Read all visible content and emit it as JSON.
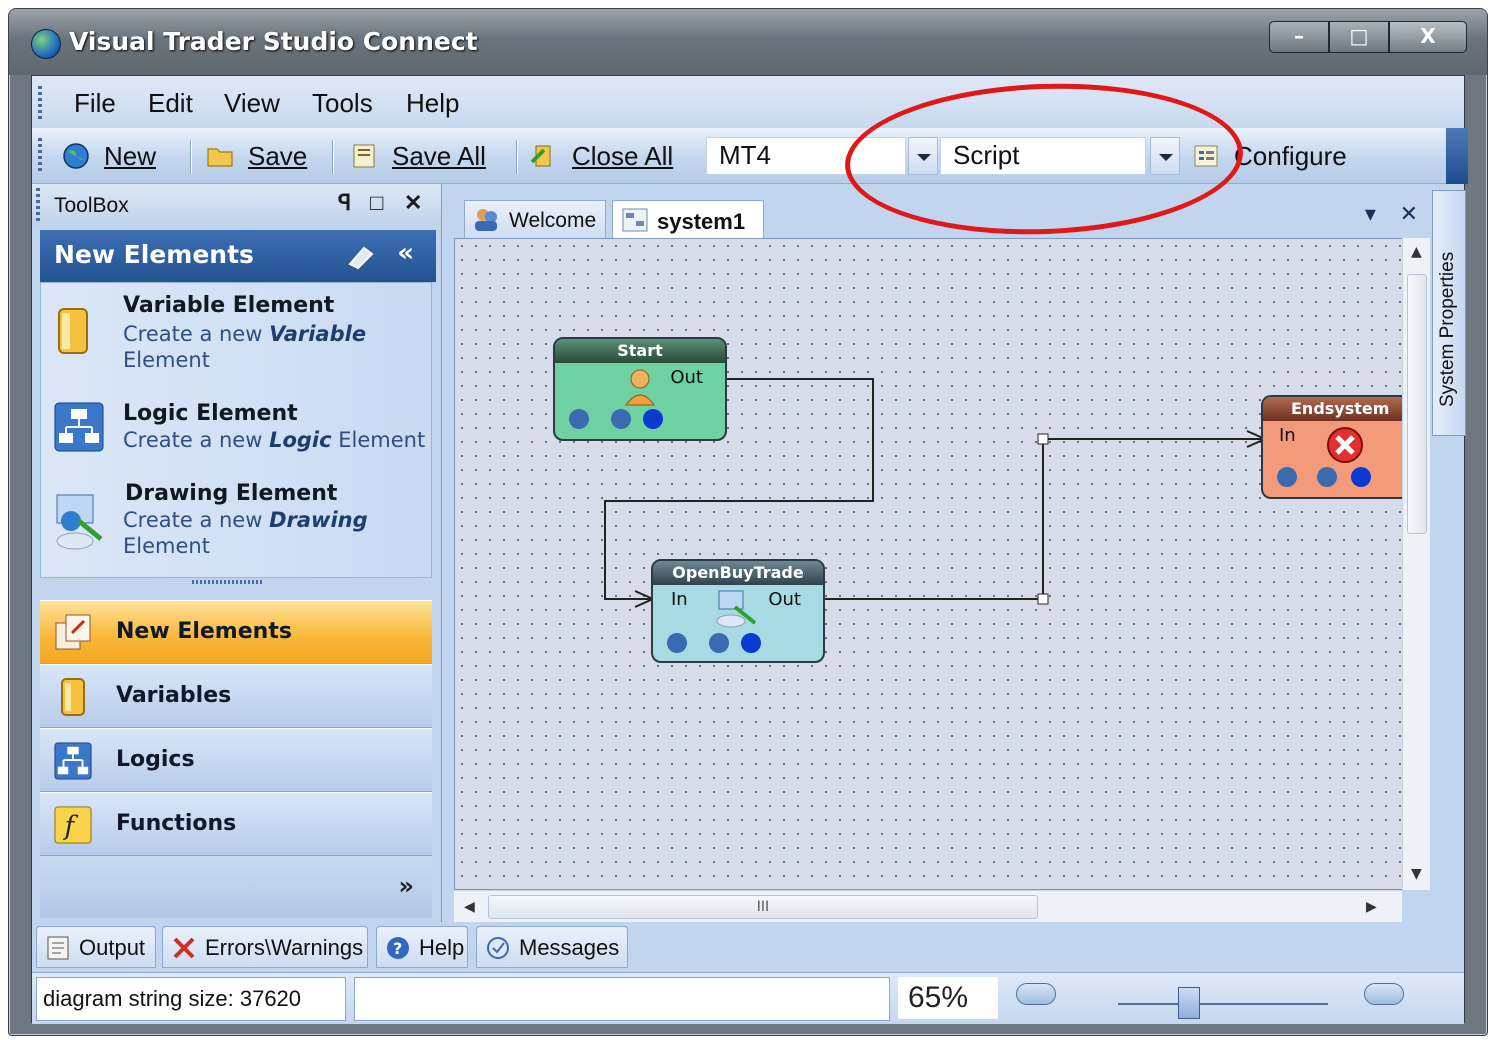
{
  "window": {
    "title": "Visual Trader Studio Connect",
    "buttons": [
      "–",
      "□",
      "X"
    ]
  },
  "menu": {
    "items": [
      "File",
      "Edit",
      "View",
      "Tools",
      "Help"
    ]
  },
  "toolbar": {
    "new_label": "New",
    "save_label": "Save",
    "save_all_label": "Save All",
    "close_all_label": "Close All",
    "platform_value": "MT4",
    "mode_value": "Script",
    "configure_label": "Configure"
  },
  "toolbox": {
    "title": "ToolBox",
    "header_buttons": [
      "ꟼ",
      "□",
      "✕"
    ],
    "section_title": "New Elements",
    "elements": [
      {
        "title": "Variable Element",
        "desc_pre": "Create  a new ",
        "desc_em": "Variable",
        "desc_post": " Element",
        "icon": "variable-icon"
      },
      {
        "title": "Logic Element",
        "desc_pre": "Create  a new ",
        "desc_em": "Logic",
        "desc_post": " Element",
        "icon": "logic-icon"
      },
      {
        "title": "Drawing Element",
        "desc_pre": "Create  a new ",
        "desc_em": "Drawing",
        "desc_post": " Element",
        "icon": "drawing-icon"
      }
    ],
    "nav": [
      {
        "label": "New Elements",
        "icon": "new-elements-icon",
        "active": true
      },
      {
        "label": "Variables",
        "icon": "variables-icon",
        "active": false
      },
      {
        "label": "Logics",
        "icon": "logics-icon",
        "active": false
      },
      {
        "label": "Functions",
        "icon": "functions-icon",
        "active": false
      }
    ]
  },
  "documents": {
    "tabs": [
      {
        "label": "Welcome",
        "active": false
      },
      {
        "label": "system1",
        "active": true
      }
    ],
    "scroll_grip": "III"
  },
  "diagram": {
    "nodes": [
      {
        "title": "Start",
        "ports": [
          "Out"
        ]
      },
      {
        "title": "OpenBuyTrade",
        "ports": [
          "In",
          "Out"
        ]
      },
      {
        "title": "Endsystem",
        "ports": [
          "In"
        ]
      }
    ]
  },
  "side_panel": {
    "label": "System Properties"
  },
  "bottom_tabs": [
    "Output",
    "Errors\\Warnings",
    "Help",
    "Messages"
  ],
  "status": {
    "text": "diagram string size: 37620",
    "zoom": "65%"
  },
  "colors": {
    "accent": "#f5a623",
    "header_blue": "#23528f",
    "annotation": "#e01818"
  }
}
